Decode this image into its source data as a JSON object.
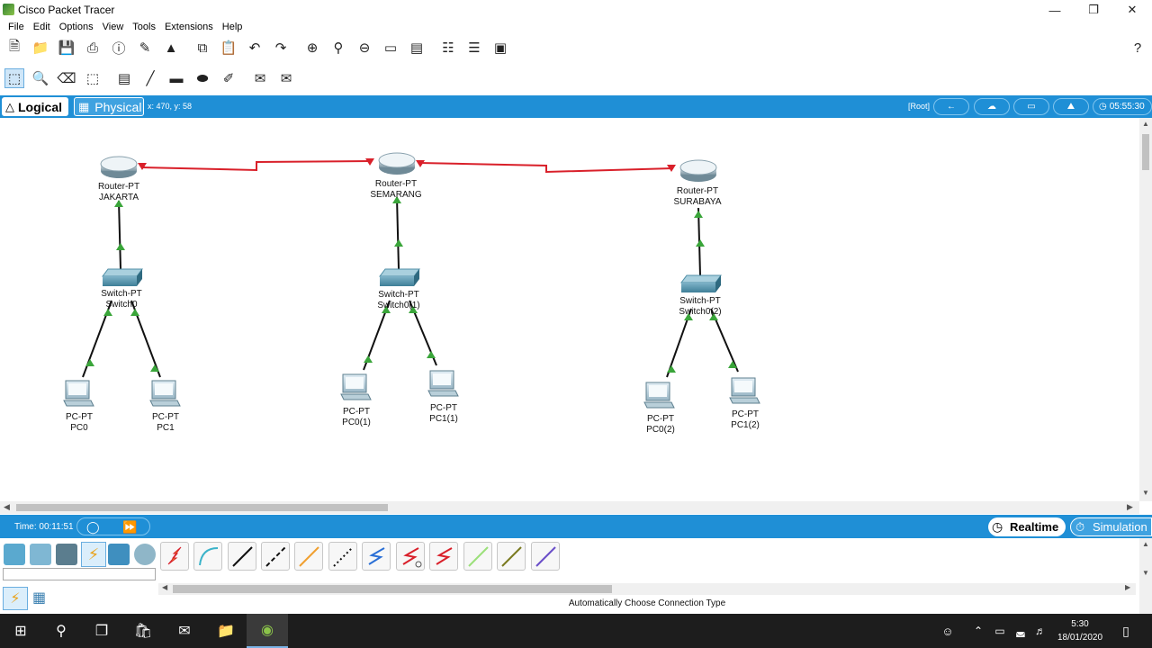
{
  "window": {
    "title": "Cisco Packet Tracer"
  },
  "menu": [
    "File",
    "Edit",
    "Options",
    "View",
    "Tools",
    "Extensions",
    "Help"
  ],
  "tabs": {
    "logical": "Logical",
    "physical": "Physical"
  },
  "cursor_coords": "x: 470, y: 58",
  "topbar": {
    "root": "[Root]",
    "clock": "05:55:30"
  },
  "devices": {
    "routers": [
      {
        "model": "Router-PT",
        "name": "JAKARTA"
      },
      {
        "model": "Router-PT",
        "name": "SEMARANG"
      },
      {
        "model": "Router-PT",
        "name": "SURABAYA"
      }
    ],
    "switches": [
      {
        "model": "Switch-PT",
        "name": "Switch0"
      },
      {
        "model": "Switch-PT",
        "name": "Switch0(1)"
      },
      {
        "model": "Switch-PT",
        "name": "Switch0(2)"
      }
    ],
    "pcs": [
      {
        "model": "PC-PT",
        "name": "PC0"
      },
      {
        "model": "PC-PT",
        "name": "PC1"
      },
      {
        "model": "PC-PT",
        "name": "PC0(1)"
      },
      {
        "model": "PC-PT",
        "name": "PC1(1)"
      },
      {
        "model": "PC-PT",
        "name": "PC0(2)"
      },
      {
        "model": "PC-PT",
        "name": "PC1(2)"
      }
    ]
  },
  "bottom": {
    "time": "Time: 00:11:51",
    "realtime": "Realtime",
    "simulation": "Simulation"
  },
  "status": "Automatically Choose Connection Type",
  "taskbar": {
    "time": "5:30",
    "date": "18/01/2020"
  },
  "colors": {
    "accent": "#1f8fd6",
    "serial_link": "#d9202a",
    "link_up": "#3aa53a"
  }
}
